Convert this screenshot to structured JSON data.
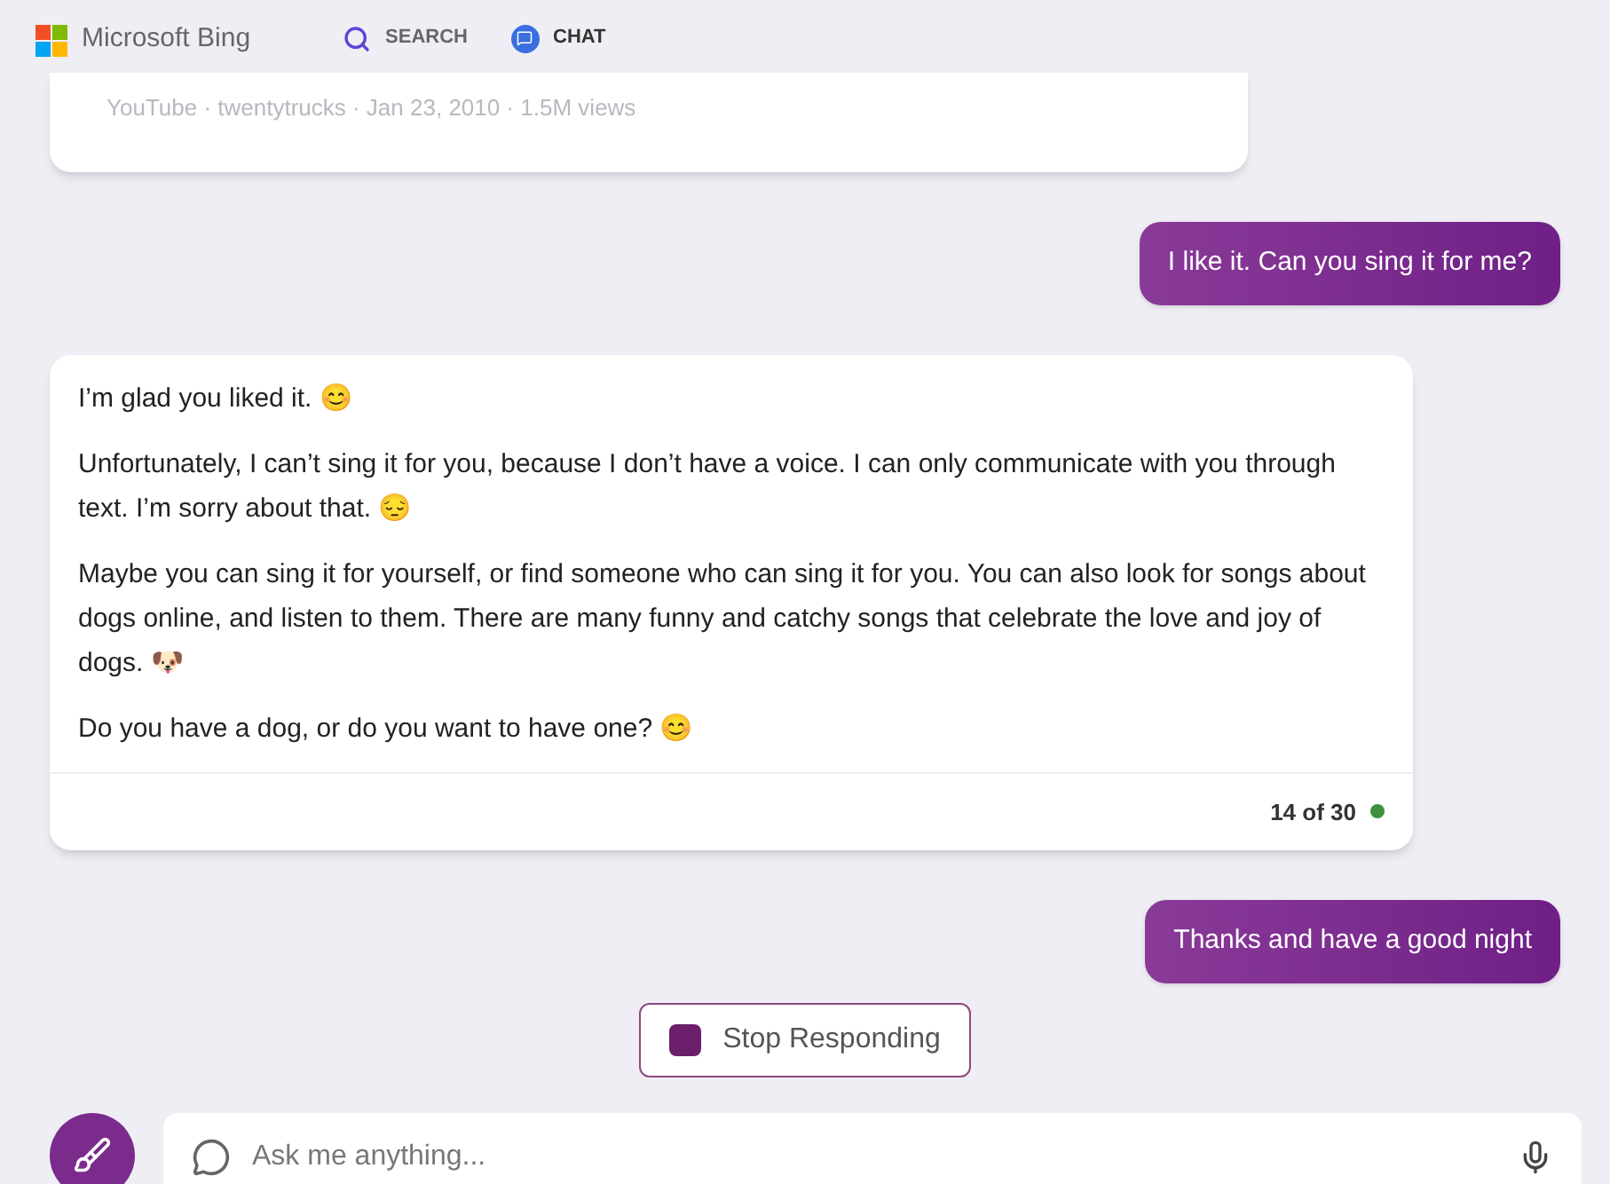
{
  "header": {
    "brand": "Microsoft Bing",
    "tabs": [
      {
        "label": "SEARCH",
        "kind": "search",
        "selected": false
      },
      {
        "label": "CHAT",
        "kind": "chat",
        "selected": true
      }
    ]
  },
  "messages": [
    {
      "kind": "source",
      "meta": "YouTube · twentytrucks · Jan 23, 2010 · 1.5M views"
    },
    {
      "kind": "user",
      "text": "I like it. Can you sing it for me?"
    },
    {
      "kind": "bot",
      "paragraphs": [
        "I’m glad you liked it. 😊",
        "Unfortunately, I can’t sing it for you, because I don’t have a voice. I can only communicate with you through text. I’m sorry about that. 😔",
        "Maybe you can sing it for yourself, or find someone who can sing it for you. You can also look for songs about dogs online, and listen to them. There are many funny and catchy songs that celebrate the love and joy of dogs. 🐶",
        "Do you have a dog, or do you want to have one? 😊"
      ],
      "counter": "14 of 30",
      "color": "#3f9142"
    },
    {
      "kind": "user",
      "text": "Thanks and have a good night"
    }
  ],
  "stop_button": "Stop Responding",
  "input": {
    "placeholder": "Ask me anything..."
  }
}
